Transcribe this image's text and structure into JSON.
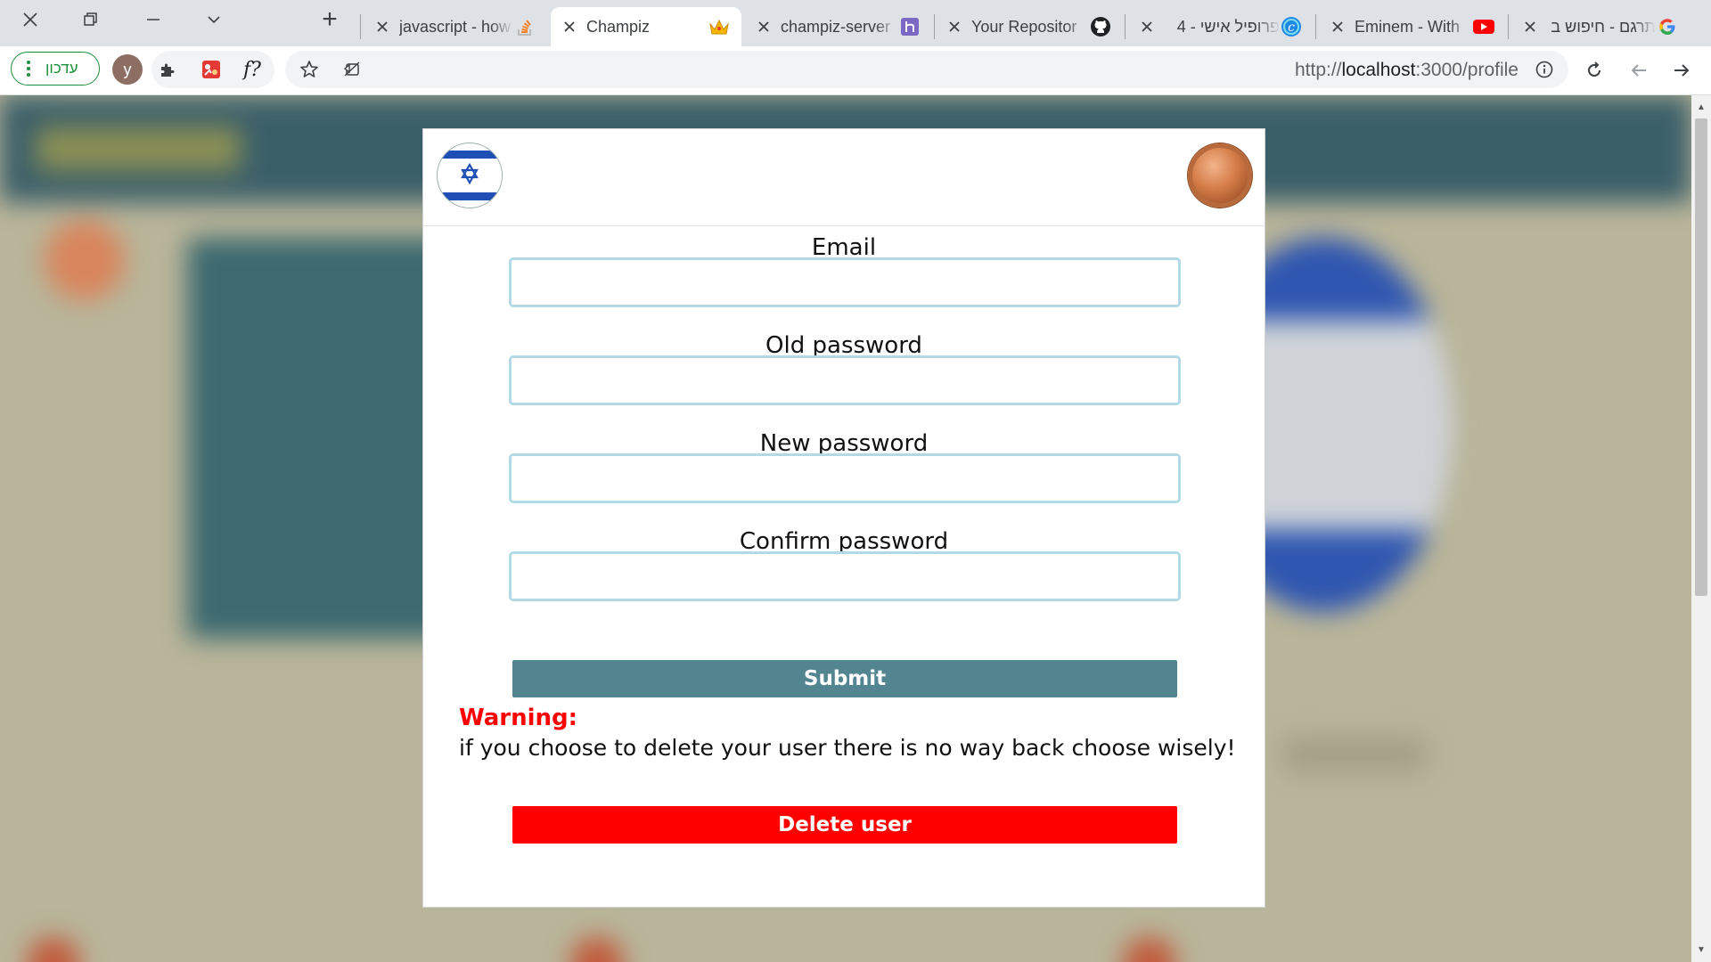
{
  "window": {
    "controls": [
      "close-icon",
      "restore-icon",
      "minimize-icon",
      "tab-search-icon"
    ],
    "new_tab_label": "+"
  },
  "tabs": [
    {
      "title": "javascript - how",
      "favicon": "stackoverflow-icon",
      "active": false,
      "rtl": false
    },
    {
      "title": "Champiz",
      "favicon": "crown-icon",
      "active": true,
      "rtl": false
    },
    {
      "title": "champiz-server",
      "favicon": "heroku-icon",
      "active": false,
      "rtl": false
    },
    {
      "title": "Your Repositor",
      "favicon": "github-icon",
      "active": false,
      "rtl": false
    },
    {
      "title": "פרופיל אישי - 4",
      "favicon": "c-circle-icon",
      "active": false,
      "rtl": true
    },
    {
      "title": "Eminem - With",
      "favicon": "youtube-icon",
      "active": false,
      "rtl": false
    },
    {
      "title": "תרגם - חיפוש ב",
      "favicon": "google-icon",
      "active": false,
      "rtl": true
    }
  ],
  "toolbar": {
    "update_label": "עדכון",
    "avatar_letter": "y",
    "extension_fx_label": "f?",
    "url_scheme": "http://",
    "url_host": "localhost",
    "url_rest": ":3000/profile"
  },
  "form": {
    "email_label": "Email",
    "old_password_label": "Old password",
    "new_password_label": "New password",
    "confirm_password_label": "Confirm password",
    "email_value": "",
    "old_password_value": "",
    "new_password_value": "",
    "confirm_password_value": "",
    "submit_label": "Submit"
  },
  "warning": {
    "title": "Warning:",
    "text": "if you choose to delete your user there is no way back choose wisely!",
    "delete_label": "Delete user"
  },
  "colors": {
    "submit": "#52858f",
    "delete": "#ff0000",
    "warning_title": "#ff0000",
    "input_border": "#b4d9e6",
    "update_green": "#1e8e3e"
  }
}
